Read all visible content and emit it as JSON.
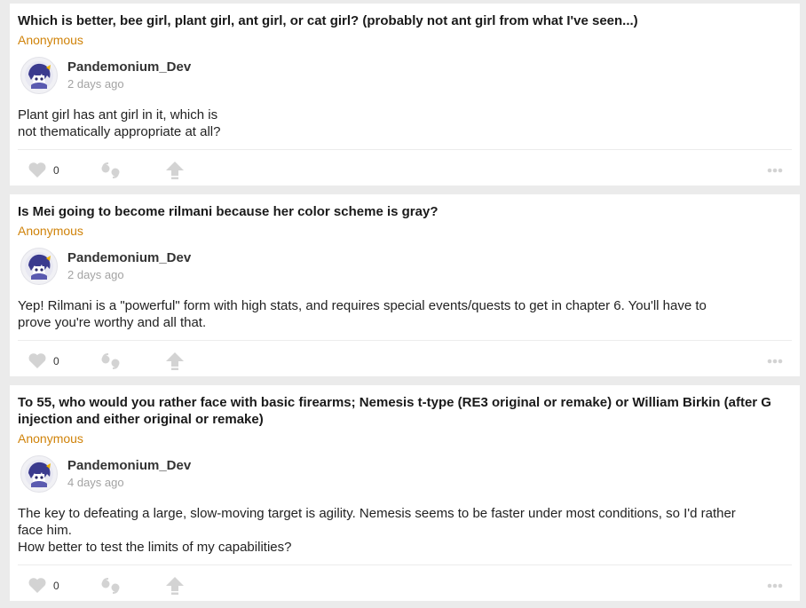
{
  "posts": [
    {
      "question": "Which is better, bee girl, plant girl, ant girl, or cat girl? (probably not ant girl from what I've seen...)",
      "asker": "Anonymous",
      "answerer": "Pandemonium_Dev",
      "time": "2 days ago",
      "answer": [
        "Plant girl has ant girl in it, which is",
        "not thematically appropriate at all?"
      ],
      "likes": "0"
    },
    {
      "question": "Is Mei going to become rilmani because her color scheme is gray?",
      "asker": "Anonymous",
      "answerer": "Pandemonium_Dev",
      "time": "2 days ago",
      "answer": [
        "Yep! Rilmani is a \"powerful\" form with high stats, and requires special events/quests to get in chapter 6. You'll have to",
        "prove you're worthy and all that."
      ],
      "likes": "0"
    },
    {
      "question": "To 55, who would you rather face with basic firearms; Nemesis t-type (RE3 original or remake) or William Birkin (after G injection and either original or remake)",
      "asker": "Anonymous",
      "answerer": "Pandemonium_Dev",
      "time": "4 days ago",
      "answer": [
        "The key to defeating a large, slow-moving target is agility. Nemesis seems to be faster under most conditions, so I'd rather",
        "face him.",
        "How better to test the limits of my capabilities?"
      ],
      "likes": "0"
    }
  ],
  "icons": {
    "like": "heart-icon",
    "quote": "quote-icon",
    "share": "arrow-up-icon",
    "more": "more-dots-icon",
    "avatar": "avatar-image"
  },
  "colors": {
    "asker": "#d0830a",
    "icon": "#d3d3d3",
    "timestamp": "#a3a3a3",
    "background": "#ebebeb"
  }
}
